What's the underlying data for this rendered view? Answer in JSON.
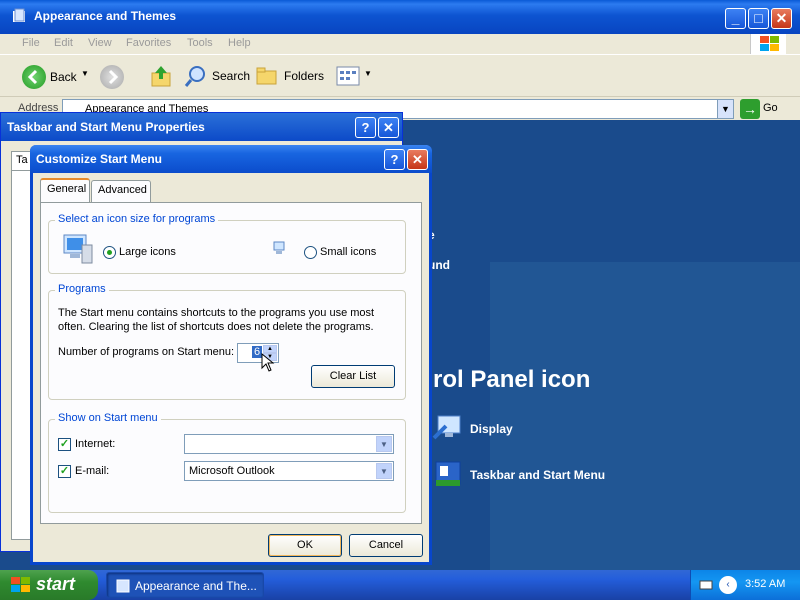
{
  "explorer": {
    "title": "Appearance and Themes",
    "menu": [
      "File",
      "Edit",
      "View",
      "Favorites",
      "Tools",
      "Help"
    ],
    "toolbar": {
      "back": "Back",
      "search": "Search",
      "folders": "Folders"
    },
    "address": {
      "label": "Address",
      "value": "Appearance and Themes",
      "go": "Go"
    },
    "content": {
      "heading_fragment": "rol Panel icon",
      "frag1": "e",
      "frag2": "und",
      "links": [
        "Display",
        "Taskbar and Start Menu"
      ]
    }
  },
  "taskbar_dialog": {
    "title": "Taskbar and Start Menu Properties",
    "tab_fragment": "Ta"
  },
  "customize": {
    "title": "Customize Start Menu",
    "tabs": [
      "General",
      "Advanced"
    ],
    "icon_size": {
      "group": "Select an icon size for programs",
      "large": "Large icons",
      "small": "Small icons",
      "selected": "large"
    },
    "programs": {
      "group": "Programs",
      "description": "The Start menu contains shortcuts to the programs you use most often. Clearing the list of shortcuts does not delete the programs.",
      "count_label": "Number of programs on Start menu:",
      "count_value": "6",
      "clear_button": "Clear List"
    },
    "show": {
      "group": "Show on Start menu",
      "internet_label": "Internet:",
      "internet_value": "",
      "internet_checked": true,
      "email_label": "E-mail:",
      "email_value": "Microsoft Outlook",
      "email_checked": true
    },
    "ok": "OK",
    "cancel": "Cancel"
  },
  "taskbar": {
    "start": "start",
    "task": "Appearance and The...",
    "clock": "3:52 AM"
  }
}
